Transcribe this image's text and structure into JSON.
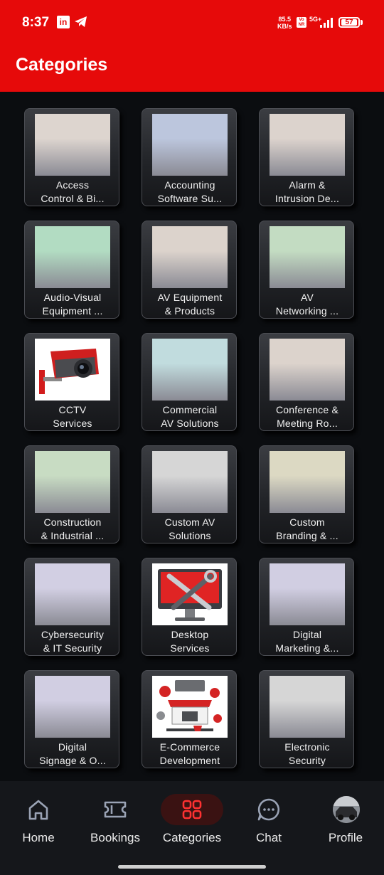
{
  "status_bar": {
    "time": "8:37",
    "app_icon_1": "LinkedIn",
    "app_icon_2": "telegram-icon",
    "speed_value": "85.5",
    "speed_unit": "KB/s",
    "volte": "Vo\nNR",
    "network": "5G+",
    "battery": "57"
  },
  "header": {
    "title": "Categories"
  },
  "categories": [
    {
      "line1": "Access",
      "line2": "Control & Bi...",
      "thumb": "#ddd5cf"
    },
    {
      "line1": "Accounting",
      "line2": "Software Su...",
      "thumb": "#bcc6dd"
    },
    {
      "line1": "Alarm &",
      "line2": "Intrusion De...",
      "thumb": "#dcd3cd"
    },
    {
      "line1": "Audio-Visual",
      "line2": "Equipment ...",
      "thumb": "#b2dcc2"
    },
    {
      "line1": "AV Equipment",
      "line2": "& Products",
      "thumb": "#dcd3cc"
    },
    {
      "line1": "AV",
      "line2": "Networking ...",
      "thumb": "#c3dcc2"
    },
    {
      "line1": "CCTV",
      "line2": "Services",
      "thumb": "cctv"
    },
    {
      "line1": "Commercial",
      "line2": "AV Solutions",
      "thumb": "#c1dcde"
    },
    {
      "line1": "Conference &",
      "line2": "Meeting Ro...",
      "thumb": "#dcd3cc"
    },
    {
      "line1": "Construction",
      "line2": "& Industrial ...",
      "thumb": "#c8dcc3"
    },
    {
      "line1": "Custom AV",
      "line2": "Solutions",
      "thumb": "#d6d6d6"
    },
    {
      "line1": "Custom",
      "line2": "Branding & ...",
      "thumb": "#dcd9c3"
    },
    {
      "line1": "Cybersecurity",
      "line2": "& IT Security",
      "thumb": "#d2cfe3"
    },
    {
      "line1": "Desktop",
      "line2": "Services",
      "thumb": "desktop"
    },
    {
      "line1": "Digital",
      "line2": "Marketing &...",
      "thumb": "#d1cee2"
    },
    {
      "line1": "Digital",
      "line2": "Signage & O...",
      "thumb": "#d1cee2"
    },
    {
      "line1": "E-Commerce",
      "line2": "Development",
      "thumb": "ecommerce"
    },
    {
      "line1": "Electronic",
      "line2": "Security",
      "thumb": "#d6d6d6"
    }
  ],
  "bottom_nav": [
    {
      "label": "Home",
      "icon": "home-icon"
    },
    {
      "label": "Bookings",
      "icon": "ticket-icon"
    },
    {
      "label": "Categories",
      "icon": "grid-icon",
      "active": true
    },
    {
      "label": "Chat",
      "icon": "chat-icon"
    },
    {
      "label": "Profile",
      "icon": "avatar"
    }
  ],
  "colors": {
    "primary": "#e60a0a",
    "background": "#0b0d10",
    "nav_bg": "#15171b",
    "active_pill": "#3a1212"
  }
}
